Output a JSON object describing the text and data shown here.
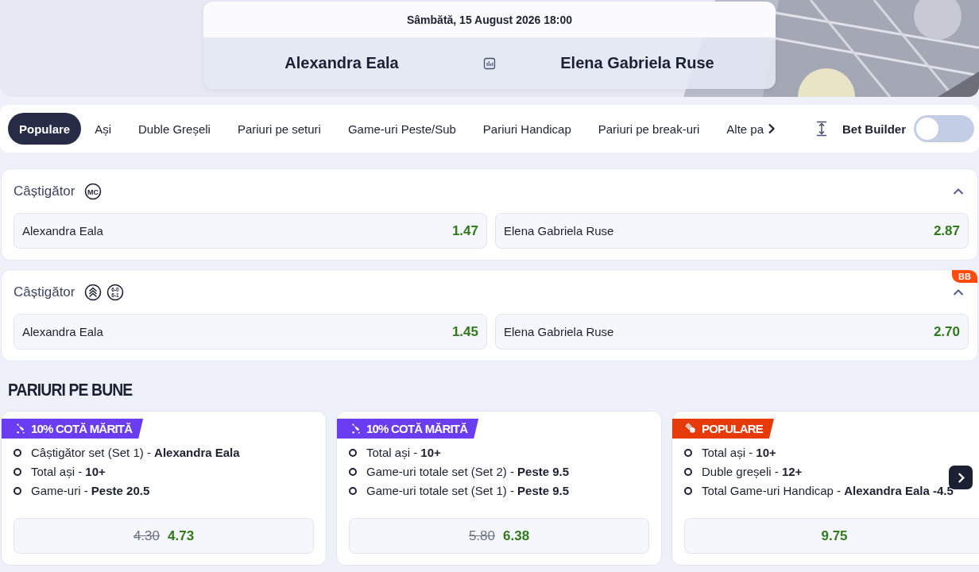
{
  "match": {
    "date": "Sâmbătă, 15 August 2026 18:00",
    "home": "Alexandra Eala",
    "away": "Elena Gabriela Ruse"
  },
  "tabs": [
    {
      "label": "Populare",
      "selected": true
    },
    {
      "label": "Ași",
      "selected": false
    },
    {
      "label": "Duble Greșeli",
      "selected": false
    },
    {
      "label": "Pariuri pe seturi",
      "selected": false
    },
    {
      "label": "Game-uri Peste/Sub",
      "selected": false
    },
    {
      "label": "Pariuri Handicap",
      "selected": false
    },
    {
      "label": "Pariuri pe break-uri",
      "selected": false
    },
    {
      "label": "Alte pa",
      "selected": false
    }
  ],
  "bet_builder": {
    "label": "Bet Builder",
    "on": false
  },
  "markets": [
    {
      "title": "Câștigător",
      "expanded": true,
      "icons": [
        {
          "kind": "mc",
          "text": "MC"
        }
      ],
      "outcomes": [
        {
          "name": "Alexandra Eala",
          "odds": "1.47"
        },
        {
          "name": "Elena Gabriela Ruse",
          "odds": "2.87"
        }
      ]
    },
    {
      "title": "Câștigător",
      "expanded": true,
      "badge": "BB",
      "icons": [
        {
          "kind": "chevrons"
        },
        {
          "kind": "score",
          "lines": [
            "6-0",
            "6-1"
          ]
        }
      ],
      "outcomes": [
        {
          "name": "Alexandra Eala",
          "odds": "1.45"
        },
        {
          "name": "Elena Gabriela Ruse",
          "odds": "2.70"
        }
      ]
    }
  ],
  "section_title": "PARIURI PE BUNE",
  "bet_cards": [
    {
      "tag": {
        "kind": "boost",
        "label": "10% COTĂ MĂRITĂ"
      },
      "legs": [
        "Câștigător set (Set 1) - **Alexandra Eala**",
        "Total ași - **10+**",
        "Game-uri - **Peste 20.5**"
      ],
      "old_odds": "4.30",
      "odds": "4.73"
    },
    {
      "tag": {
        "kind": "boost",
        "label": "10% COTĂ MĂRITĂ"
      },
      "legs": [
        "Total ași - **10+**",
        "Game-uri totale set (Set 2) - **Peste 9.5**",
        "Game-uri totale set (Set 1) - **Peste 9.5**"
      ],
      "old_odds": "5.80",
      "odds": "6.38"
    },
    {
      "tag": {
        "kind": "popular",
        "label": "POPULARE"
      },
      "legs": [
        "Total ași - **10+**",
        "Duble greșeli - **12+**",
        "Total Game-uri Handicap - **Alexandra Eala -4.5**"
      ],
      "odds": "9.75"
    }
  ]
}
